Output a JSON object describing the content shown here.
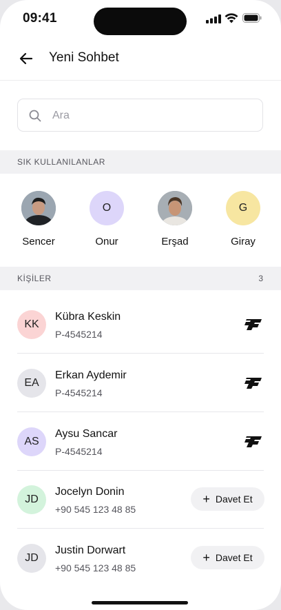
{
  "status": {
    "time": "09:41"
  },
  "header": {
    "title": "Yeni Sohbet"
  },
  "search": {
    "placeholder": "Ara"
  },
  "favorites": {
    "label": "SIK KULLANILANLAR",
    "items": [
      {
        "name": "Sencer",
        "initial": "",
        "photo": true,
        "color": "#8a96a3"
      },
      {
        "name": "Onur",
        "initial": "O",
        "photo": false,
        "color": "#ddd6fa"
      },
      {
        "name": "Erşad",
        "initial": "",
        "photo": true,
        "color": "#9aa3ab"
      },
      {
        "name": "Giray",
        "initial": "G",
        "photo": false,
        "color": "#f7e6a1"
      }
    ]
  },
  "contacts": {
    "label": "KİŞİLER",
    "count": "3",
    "items": [
      {
        "initials": "KK",
        "name": "Kübra Keskin",
        "sub": "P-4545214",
        "color": "#fbd4d4",
        "action": "logo"
      },
      {
        "initials": "EA",
        "name": "Erkan Aydemir",
        "sub": "P-4545214",
        "color": "#e5e5ea",
        "action": "logo"
      },
      {
        "initials": "AS",
        "name": "Aysu Sancar",
        "sub": "P-4545214",
        "color": "#ddd6fa",
        "action": "logo"
      },
      {
        "initials": "JD",
        "name": "Jocelyn Donin",
        "sub": "+90 545 123 48 85",
        "color": "#d3f3dc",
        "action": "invite",
        "invite_label": "Davet Et"
      },
      {
        "initials": "JD",
        "name": "Justin Dorwart",
        "sub": "+90 545 123 48 85",
        "color": "#e5e5ea",
        "action": "invite",
        "invite_label": "Davet Et"
      }
    ]
  }
}
